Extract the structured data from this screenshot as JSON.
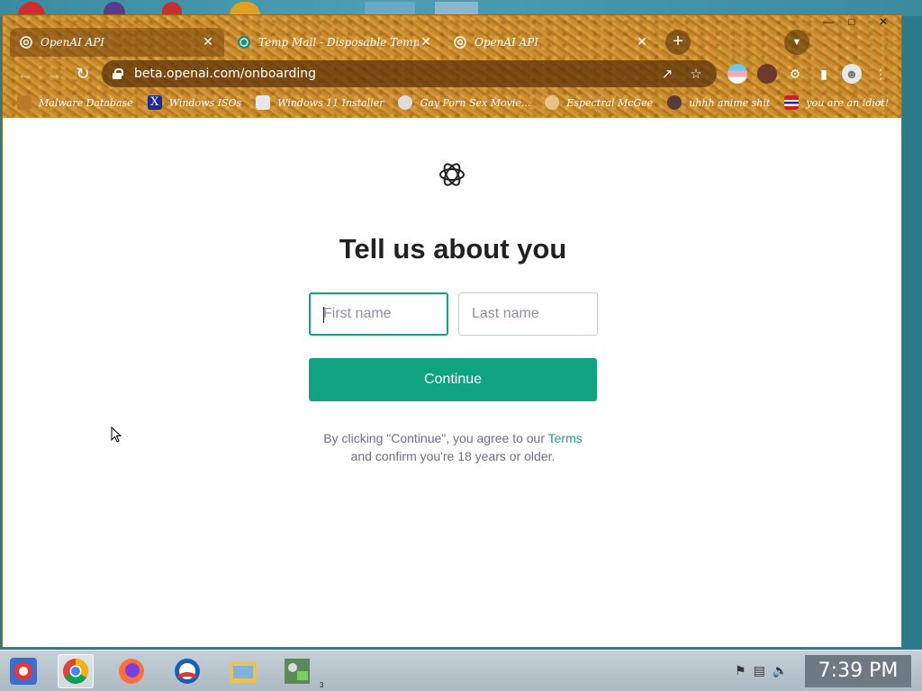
{
  "browser": {
    "tabs": [
      {
        "title": "OpenAI API",
        "favicon": "openai-icon",
        "active": true
      },
      {
        "title": "Temp Mail - Disposable Temporary",
        "favicon": "tempmail-icon",
        "active": false
      },
      {
        "title": "OpenAI API",
        "favicon": "openai-icon",
        "active": false
      }
    ],
    "new_tab": "+",
    "url": "beta.openai.com/onboarding",
    "bookmarks": [
      {
        "label": "Malware Database",
        "icon": "malware-icon"
      },
      {
        "label": "Windows ISOs",
        "icon": "x-icon"
      },
      {
        "label": "Windows 11 Installer",
        "icon": "installer-icon"
      },
      {
        "label": "Gay Porn Sex Movie...",
        "icon": "site-icon"
      },
      {
        "label": "Espectral McGee",
        "icon": "avatar-icon"
      },
      {
        "label": "uhhh anime shit",
        "icon": "anime-icon"
      },
      {
        "label": "you are an idiot!",
        "icon": "flag-icon"
      }
    ],
    "bookmarks_more": "»"
  },
  "page": {
    "heading": "Tell us about you",
    "first_name_placeholder": "First name",
    "last_name_placeholder": "Last name",
    "continue_label": "Continue",
    "legal_prefix": "By clicking \"Continue\", you agree to our ",
    "legal_link": "Terms",
    "legal_suffix": "and confirm you're 18 years or older.",
    "accent_color": "#10a37f"
  },
  "taskbar": {
    "apps": [
      "chrome-alt-icon",
      "chrome-icon",
      "firefox-icon",
      "obama-icon",
      "file-explorer-icon",
      "network-app-icon"
    ],
    "active_app": "chrome-icon",
    "badge": "3",
    "clock": "7:39 PM"
  }
}
